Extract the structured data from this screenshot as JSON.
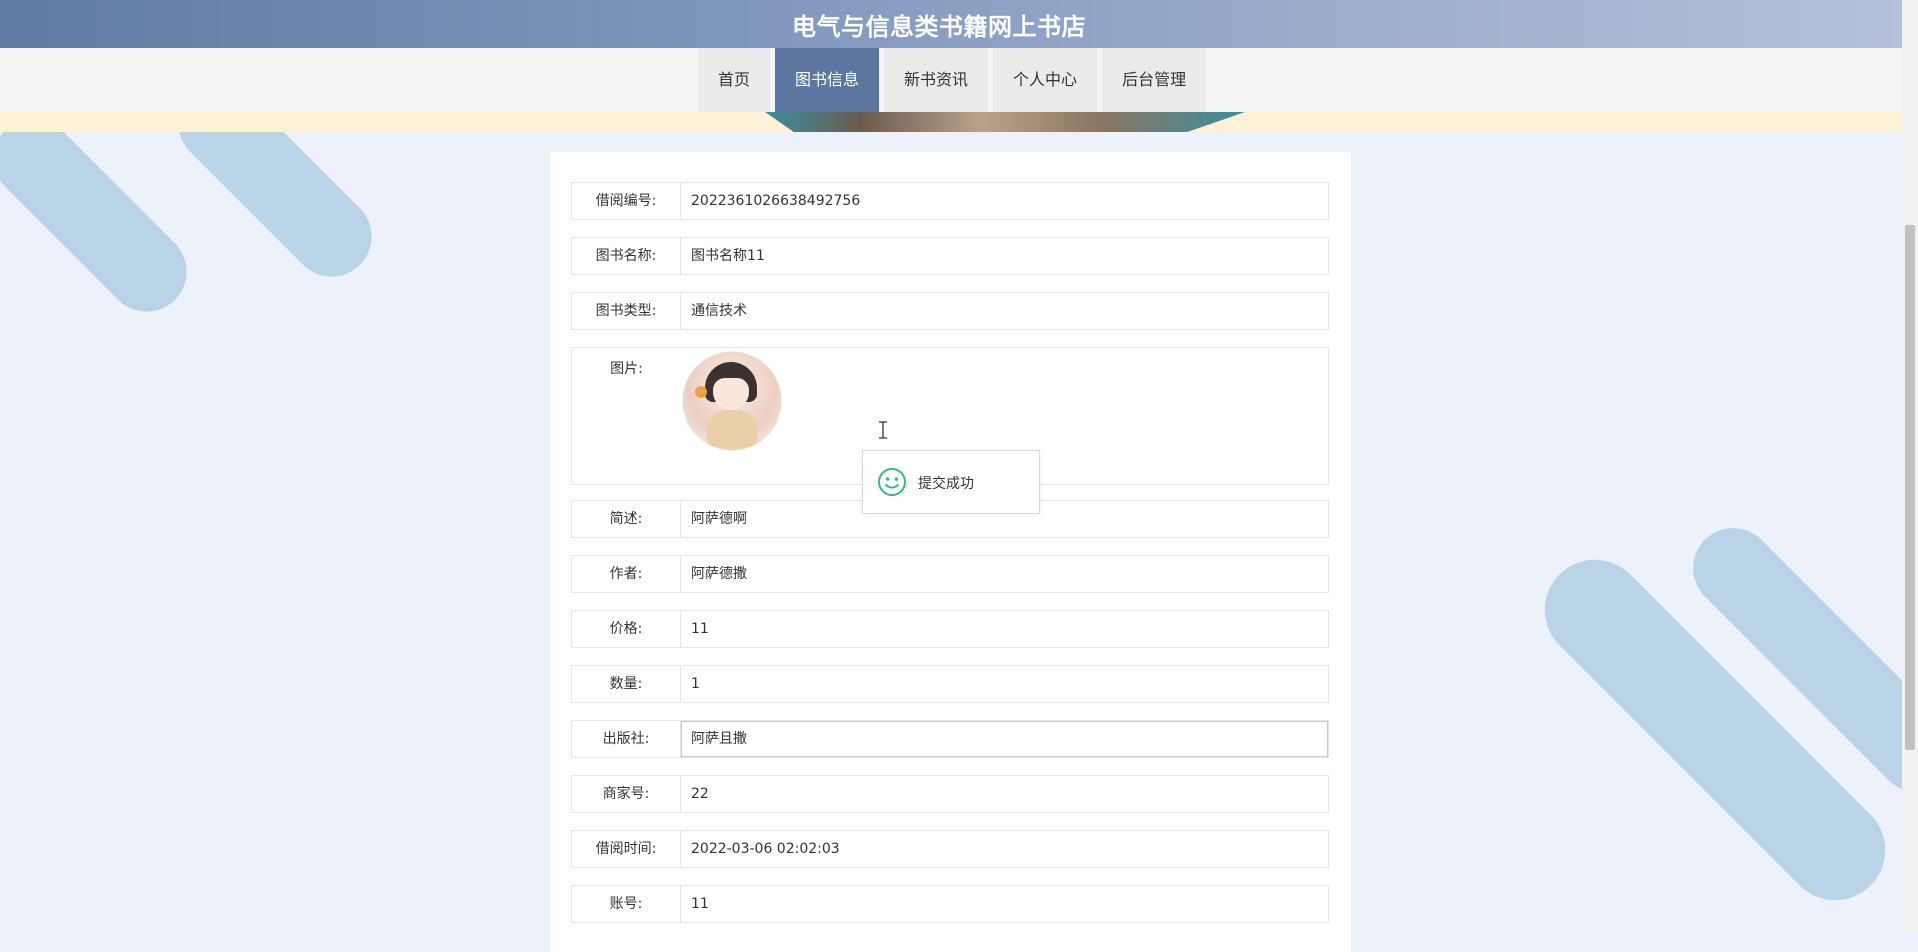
{
  "header": {
    "site_title": "电气与信息类书籍网上书店"
  },
  "nav": {
    "items": [
      {
        "label": "首页",
        "active": false
      },
      {
        "label": "图书信息",
        "active": true
      },
      {
        "label": "新书资讯",
        "active": false
      },
      {
        "label": "个人中心",
        "active": false
      },
      {
        "label": "后台管理",
        "active": false
      }
    ]
  },
  "form": {
    "borrow_no": {
      "label": "借阅编号:",
      "value": "2022361026638492756"
    },
    "book_name": {
      "label": "图书名称:",
      "value": "图书名称11"
    },
    "book_type": {
      "label": "图书类型:",
      "value": "通信技术"
    },
    "image": {
      "label": "图片:"
    },
    "summary": {
      "label": "简述:",
      "value": "阿萨德啊"
    },
    "author": {
      "label": "作者:",
      "value": "阿萨德撒"
    },
    "price": {
      "label": "价格:",
      "value": "11"
    },
    "quantity": {
      "label": "数量:",
      "value": "1"
    },
    "publisher": {
      "label": "出版社:",
      "value": "阿萨且撒"
    },
    "merchant_no": {
      "label": "商家号:",
      "value": "22"
    },
    "borrow_time": {
      "label": "借阅时间:",
      "value": "2022-03-06 02:02:03"
    },
    "account": {
      "label": "账号:",
      "value": "11"
    }
  },
  "toast": {
    "text": "提交成功",
    "icon": "smile-icon",
    "color": "#3cb878"
  },
  "colors": {
    "header_start": "#5f7aa3",
    "nav_active": "#5e77a0",
    "background": "#edf1fa",
    "decoration": "#b8d4e6"
  }
}
